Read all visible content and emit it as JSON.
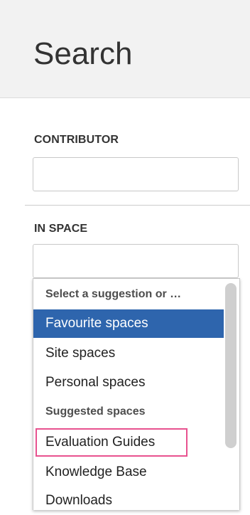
{
  "header": {
    "title": "Search"
  },
  "contributor": {
    "label": "CONTRIBUTOR",
    "value": ""
  },
  "in_space": {
    "label": "IN SPACE",
    "value": ""
  },
  "dropdown": {
    "prompt": "Select a suggestion or …",
    "items": [
      {
        "label": "Favourite spaces",
        "state": "highlighted"
      },
      {
        "label": "Site spaces"
      },
      {
        "label": "Personal spaces"
      }
    ],
    "suggested_header": "Suggested spaces",
    "suggested_items": [
      {
        "label": "Evaluation Guides",
        "state": "outlined"
      },
      {
        "label": "Knowledge Base"
      },
      {
        "label": "Downloads"
      }
    ]
  },
  "colors": {
    "highlight": "#2e65ad",
    "outline": "#e8528f",
    "header_bg": "#f2f2f2"
  }
}
